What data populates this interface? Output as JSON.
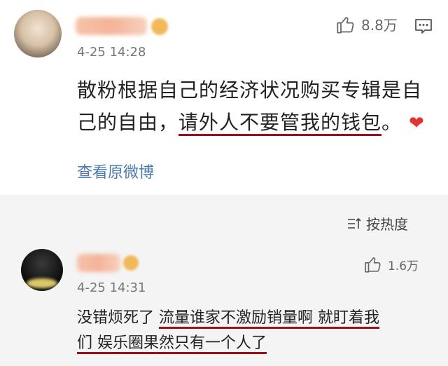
{
  "comment1": {
    "time": "4-25 14:28",
    "likes": "8.8万",
    "text_plain": "散粉根据自己的经济状况购买专辑是自己的自由，",
    "text_underlined": "请外人不要管我的钱包",
    "text_end": "。",
    "heart": "❤",
    "view_original": "查看原微博"
  },
  "sort": {
    "label": "按热度"
  },
  "comment2": {
    "time": "4-25 14:31",
    "likes": "1.6万",
    "text_plain": "没错烦死了 ",
    "text_underlined_1": "流量谁家不激励销量啊 就盯着我",
    "text_underlined_2": "们 娱乐圈果然只有一个人了"
  },
  "icons": {
    "like": "thumbs-up-icon",
    "more": "comment-more-icon",
    "sort": "sort-icon"
  }
}
